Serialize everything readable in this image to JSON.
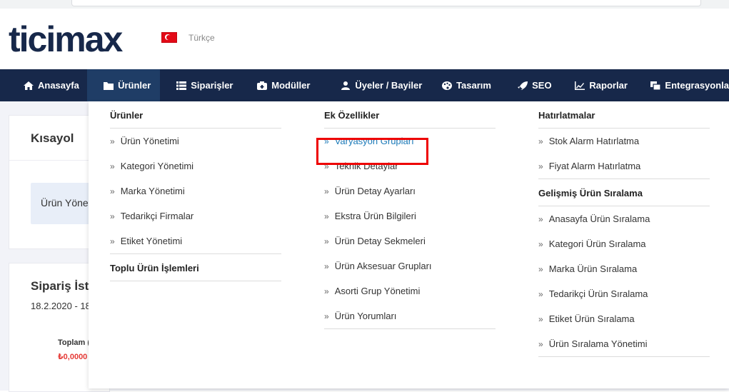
{
  "header": {
    "logo_text": "ticimax",
    "language": "Türkçe"
  },
  "nav": [
    {
      "label": "Anasayfa",
      "icon": "home-icon"
    },
    {
      "label": "Ürünler",
      "icon": "folder-icon",
      "active": true
    },
    {
      "label": "Siparişler",
      "icon": "list-icon"
    },
    {
      "label": "Modüller",
      "icon": "module-icon"
    },
    {
      "label": "Üyeler / Bayiler",
      "icon": "users-icon"
    },
    {
      "label": "Tasarım",
      "icon": "palette-icon"
    },
    {
      "label": "SEO",
      "icon": "rocket-icon"
    },
    {
      "label": "Raporlar",
      "icon": "chart-icon"
    },
    {
      "label": "Entegrasyonla",
      "icon": "copy-icon"
    }
  ],
  "cards": {
    "shortcut_title": "Kısayol",
    "shortcut_chip": "Ürün Yöne",
    "orders_title": "Sipariş İst",
    "orders_date": "18.2.2020 - 18",
    "orders_total_label": "Toplam (",
    "orders_total_value": "₺0,0000"
  },
  "menu": {
    "col1": {
      "heading": "Ürünler",
      "items": [
        "Ürün Yönetimi",
        "Kategori Yönetimi",
        "Marka Yönetimi",
        "Tedarikçi Firmalar",
        "Etiket Yönetimi"
      ],
      "heading2": "Toplu Ürün İşlemleri"
    },
    "col2": {
      "heading": "Ek Özellikler",
      "items": [
        "Varyasyon Grupları",
        "Teknik Detaylar",
        "Ürün Detay Ayarları",
        "Ekstra Ürün Bilgileri",
        "Ürün Detay Sekmeleri",
        "Ürün Aksesuar Grupları",
        "Asorti Grup Yönetimi",
        "Ürün Yorumları"
      ]
    },
    "col3": {
      "heading": "Hatırlatmalar",
      "items": [
        "Stok Alarm Hatırlatma",
        "Fiyat Alarm Hatırlatma"
      ],
      "heading2": "Gelişmiş Ürün Sıralama",
      "items2": [
        "Anasayfa Ürün Sıralama",
        "Kategori Ürün Sıralama",
        "Marka Ürün Sıralama",
        "Tedarikçi Ürün Sıralama",
        "Etiket Ürün Sıralama",
        "Ürün Sıralama Yönetimi"
      ]
    },
    "arrow": "»"
  },
  "colors": {
    "nav_bg": "#17284a",
    "nav_active": "#1f3d66",
    "highlight": "#e00000",
    "link_active": "#1b7ab8"
  }
}
